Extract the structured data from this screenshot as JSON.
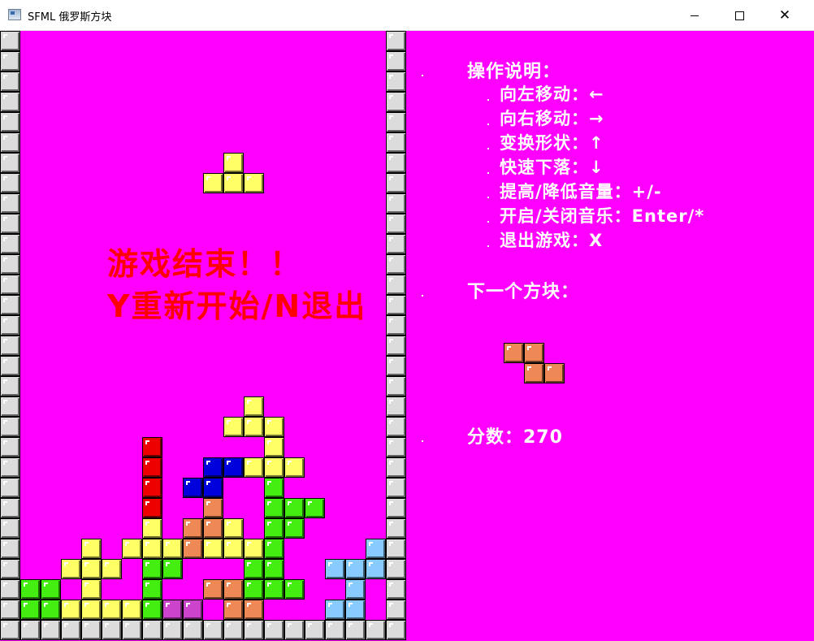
{
  "window": {
    "title": "SFML 俄罗斯方块",
    "controls": [
      "minimize",
      "maximize",
      "close"
    ]
  },
  "colors": {
    "background": "#ff00ff",
    "wall": "#dcdcdc",
    "block_outline": "#000000",
    "yellow": "#ffff66",
    "red": "#ee0000",
    "blue": "#0000dd",
    "green": "#44ee11",
    "orange": "#ee8855",
    "light_blue": "#88ccff",
    "purple": "#cc44cc",
    "game_over_text": "#ff0000",
    "side_text": "#ffffff"
  },
  "icons": {
    "app": "window-app-icon",
    "minimize": "minimize-icon",
    "maximize": "maximize-icon",
    "close": "close-icon"
  },
  "controls_help": {
    "title": "操作说明：",
    "lines": [
      "向左移动：←",
      "向右移动：→",
      "变换形状：↑",
      "快速下落：↓",
      "提高/降低音量：+/-",
      "开启/关闭音乐：Enter/*",
      "退出游戏：X"
    ]
  },
  "game_over": {
    "line1": "游戏结束！！",
    "line2": "Y重新开始/N退出"
  },
  "next_piece": {
    "label": "下一个方块：",
    "shape": "Z",
    "color": "orange",
    "cells": [
      [
        0,
        0
      ],
      [
        1,
        0
      ],
      [
        1,
        1
      ],
      [
        2,
        1
      ]
    ]
  },
  "score": {
    "label": "分数：",
    "value": "270",
    "text": "分数：270"
  },
  "board": {
    "columns": 18,
    "rows": 29,
    "falling_piece": {
      "shape": "T",
      "color": "yellow",
      "cells": [
        [
          10,
          6
        ],
        [
          9,
          7
        ],
        [
          10,
          7
        ],
        [
          11,
          7
        ]
      ]
    },
    "stack": [
      [
        11,
        18,
        "yellow"
      ],
      [
        10,
        19,
        "yellow"
      ],
      [
        11,
        19,
        "yellow"
      ],
      [
        12,
        19,
        "yellow"
      ],
      [
        6,
        20,
        "red"
      ],
      [
        12,
        20,
        "yellow"
      ],
      [
        6,
        21,
        "red"
      ],
      [
        9,
        21,
        "blue"
      ],
      [
        10,
        21,
        "blue"
      ],
      [
        11,
        21,
        "yellow"
      ],
      [
        12,
        21,
        "yellow"
      ],
      [
        13,
        21,
        "yellow"
      ],
      [
        6,
        22,
        "red"
      ],
      [
        8,
        22,
        "blue"
      ],
      [
        9,
        22,
        "blue"
      ],
      [
        12,
        22,
        "green"
      ],
      [
        6,
        23,
        "red"
      ],
      [
        9,
        23,
        "orange"
      ],
      [
        12,
        23,
        "green"
      ],
      [
        13,
        23,
        "green"
      ],
      [
        14,
        23,
        "green"
      ],
      [
        6,
        24,
        "yellow"
      ],
      [
        8,
        24,
        "orange"
      ],
      [
        9,
        24,
        "orange"
      ],
      [
        10,
        24,
        "yellow"
      ],
      [
        12,
        24,
        "green"
      ],
      [
        13,
        24,
        "green"
      ],
      [
        3,
        25,
        "yellow"
      ],
      [
        5,
        25,
        "yellow"
      ],
      [
        6,
        25,
        "yellow"
      ],
      [
        7,
        25,
        "yellow"
      ],
      [
        8,
        25,
        "orange"
      ],
      [
        9,
        25,
        "yellow"
      ],
      [
        10,
        25,
        "yellow"
      ],
      [
        11,
        25,
        "yellow"
      ],
      [
        12,
        25,
        "green"
      ],
      [
        17,
        25,
        "light_blue"
      ],
      [
        2,
        26,
        "yellow"
      ],
      [
        3,
        26,
        "yellow"
      ],
      [
        4,
        26,
        "yellow"
      ],
      [
        6,
        26,
        "green"
      ],
      [
        7,
        26,
        "green"
      ],
      [
        11,
        26,
        "green"
      ],
      [
        12,
        26,
        "green"
      ],
      [
        15,
        26,
        "light_blue"
      ],
      [
        16,
        26,
        "light_blue"
      ],
      [
        17,
        26,
        "light_blue"
      ],
      [
        0,
        27,
        "green"
      ],
      [
        1,
        27,
        "green"
      ],
      [
        3,
        27,
        "yellow"
      ],
      [
        6,
        27,
        "green"
      ],
      [
        9,
        27,
        "orange"
      ],
      [
        10,
        27,
        "orange"
      ],
      [
        11,
        27,
        "green"
      ],
      [
        12,
        27,
        "green"
      ],
      [
        13,
        27,
        "green"
      ],
      [
        16,
        27,
        "light_blue"
      ],
      [
        0,
        28,
        "green"
      ],
      [
        1,
        28,
        "green"
      ],
      [
        2,
        28,
        "yellow"
      ],
      [
        3,
        28,
        "yellow"
      ],
      [
        4,
        28,
        "yellow"
      ],
      [
        5,
        28,
        "yellow"
      ],
      [
        6,
        28,
        "green"
      ],
      [
        7,
        28,
        "purple"
      ],
      [
        8,
        28,
        "purple"
      ],
      [
        10,
        28,
        "orange"
      ],
      [
        11,
        28,
        "orange"
      ],
      [
        15,
        28,
        "light_blue"
      ],
      [
        16,
        28,
        "light_blue"
      ]
    ]
  }
}
